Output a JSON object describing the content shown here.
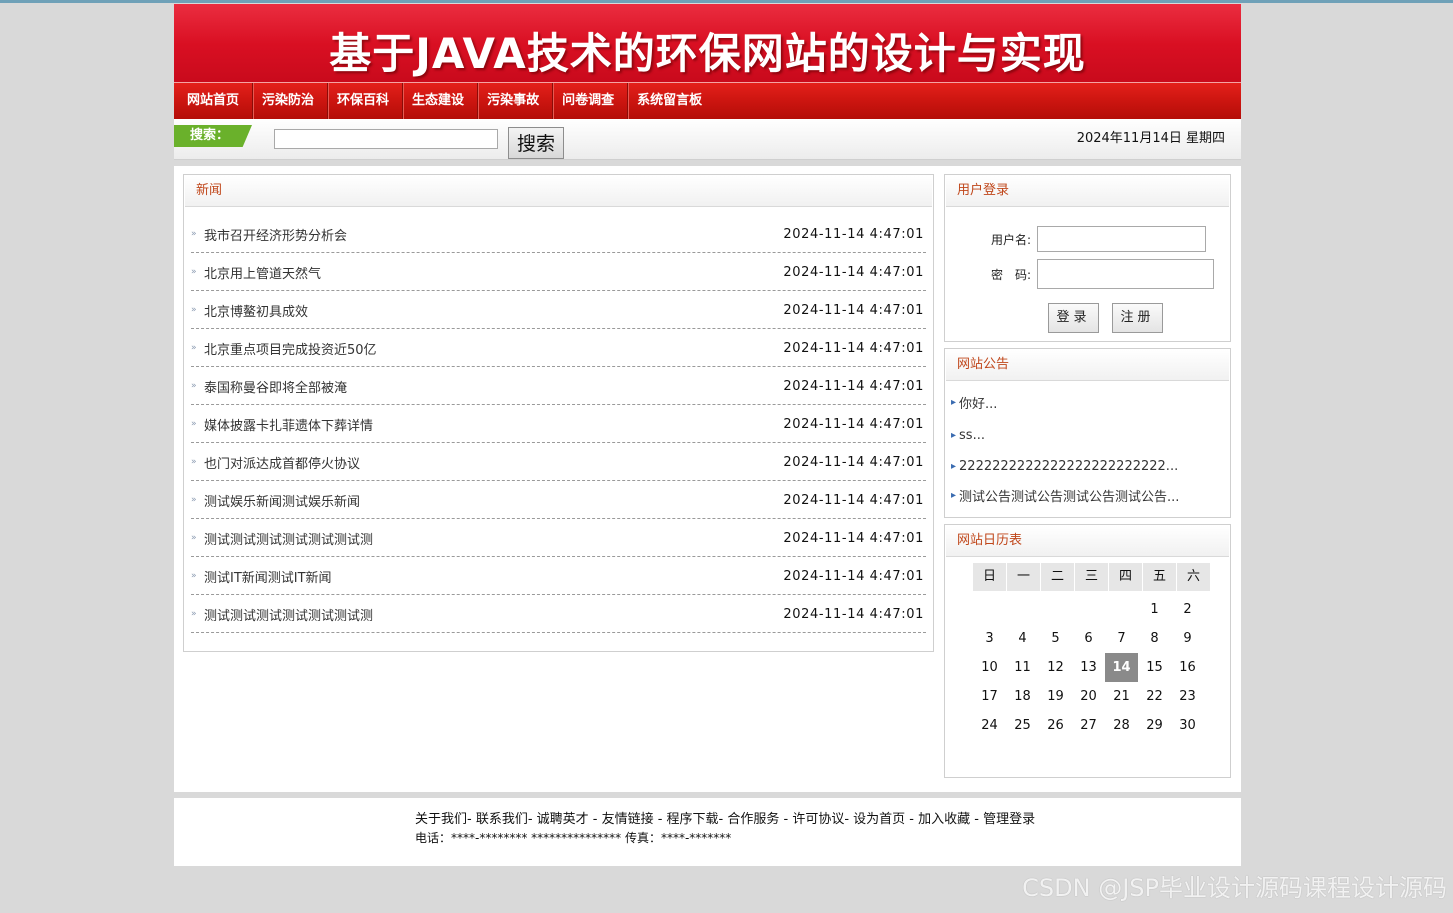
{
  "banner": {
    "title": "基于JAVA技术的环保网站的设计与实现"
  },
  "nav": {
    "items": [
      "网站首页",
      "污染防治",
      "环保百科",
      "生态建设",
      "污染事故",
      "问卷调查",
      "系统留言板"
    ]
  },
  "search": {
    "tag": "搜索：",
    "button_label": "搜索",
    "value": "",
    "placeholder": ""
  },
  "date_text": "2024年11月14日 星期四",
  "news": {
    "title": "新闻",
    "items": [
      {
        "title": "我市召开经济形势分析会",
        "time": "2024-11-14 4:47:01"
      },
      {
        "title": "北京用上管道天然气",
        "time": "2024-11-14 4:47:01"
      },
      {
        "title": "北京博鳌初具成效",
        "time": "2024-11-14 4:47:01"
      },
      {
        "title": "北京重点项目完成投资近50亿",
        "time": "2024-11-14 4:47:01"
      },
      {
        "title": "泰国称曼谷即将全部被淹",
        "time": "2024-11-14 4:47:01"
      },
      {
        "title": "媒体披露卡扎菲遗体下葬详情",
        "time": "2024-11-14 4:47:01"
      },
      {
        "title": "也门对派达成首都停火协议",
        "time": "2024-11-14 4:47:01"
      },
      {
        "title": "测试娱乐新闻测试娱乐新闻",
        "time": "2024-11-14 4:47:01"
      },
      {
        "title": "测试测试测试测试测试测试测",
        "time": "2024-11-14 4:47:01"
      },
      {
        "title": "测试IT新闻测试IT新闻",
        "time": "2024-11-14 4:47:01"
      },
      {
        "title": "测试测试测试测试测试测试测",
        "time": "2024-11-14 4:47:01"
      }
    ]
  },
  "login": {
    "title": "用户登录",
    "username_label": "用户名:",
    "password_label": "密　码:",
    "username_value": "",
    "password_value": "",
    "login_button": "登录",
    "register_button": "注册"
  },
  "notices": {
    "title": "网站公告",
    "items": [
      "你好...",
      "ss...",
      "2222222222222222222222222...",
      "测试公告测试公告测试公告测试公告..."
    ]
  },
  "calendar": {
    "title": "网站日历表",
    "weekdays": [
      "日",
      "一",
      "二",
      "三",
      "四",
      "五",
      "六"
    ],
    "weeks": [
      [
        "",
        "",
        "",
        "",
        "",
        "1",
        "2"
      ],
      [
        "3",
        "4",
        "5",
        "6",
        "7",
        "8",
        "9"
      ],
      [
        "10",
        "11",
        "12",
        "13",
        "14",
        "15",
        "16"
      ],
      [
        "17",
        "18",
        "19",
        "20",
        "21",
        "22",
        "23"
      ],
      [
        "24",
        "25",
        "26",
        "27",
        "28",
        "29",
        "30"
      ]
    ],
    "today": "14"
  },
  "footer": {
    "links": "关于我们- 联系我们- 诚聘英才 - 友情链接 - 程序下载- 合作服务 - 许可协议- 设为首页 - 加入收藏 - 管理登录",
    "contact": "电话：****-******** *************** 传真：****-*******"
  },
  "watermark": "CSDN @JSP毕业设计源码课程设计源码"
}
